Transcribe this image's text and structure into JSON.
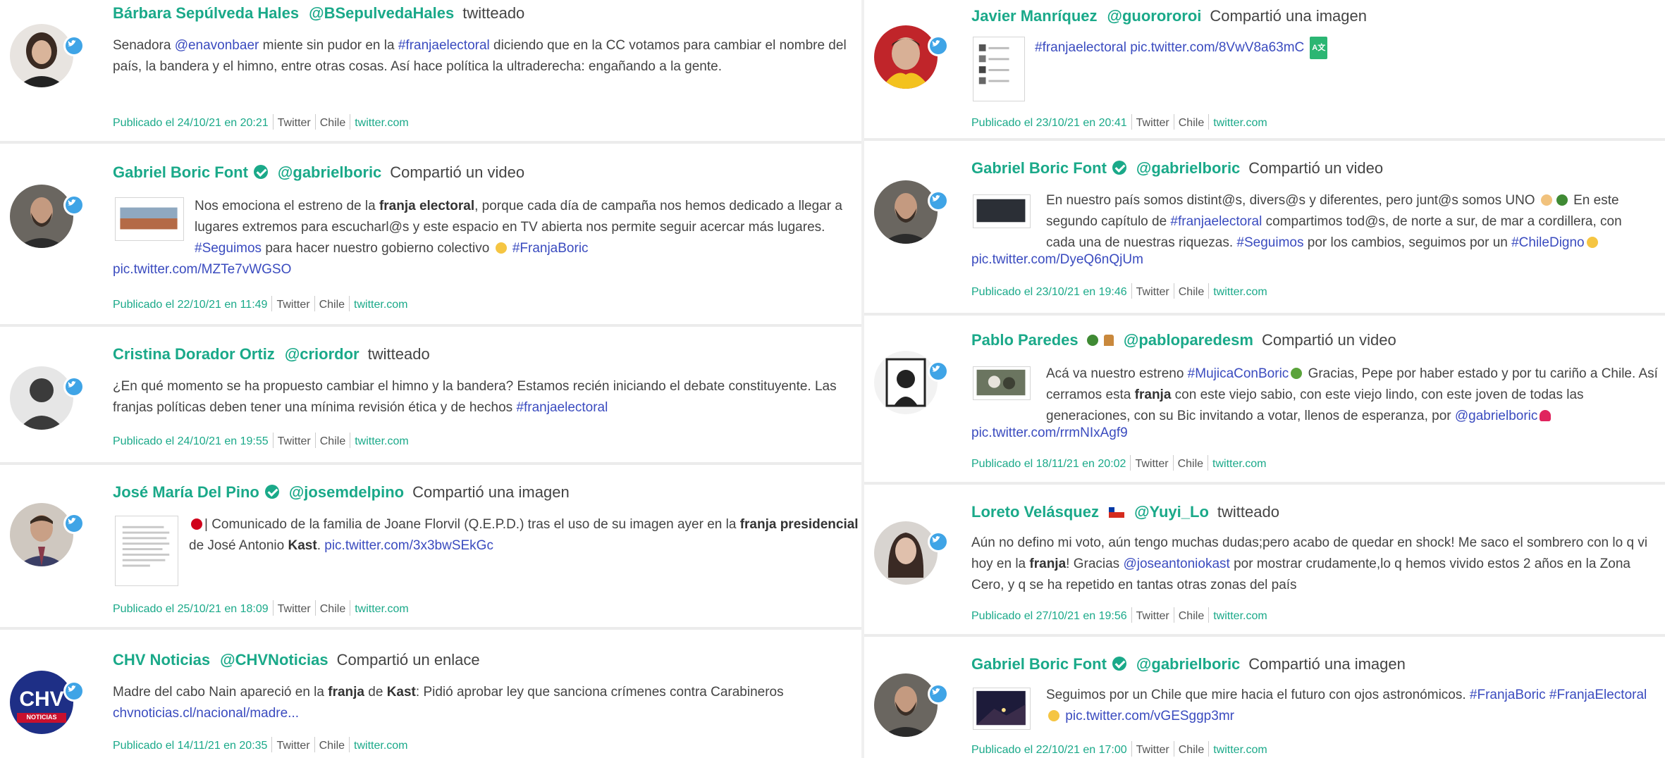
{
  "left": [
    {
      "author": "Bárbara Sepúlveda Hales",
      "handle": "@BSepulvedaHales",
      "action": "twitteado",
      "body": [
        {
          "t": "Senadora "
        },
        {
          "t": "@enavonbaer",
          "h": 1
        },
        {
          "t": " miente sin pudor en la "
        },
        {
          "t": "#franjaelectoral",
          "h": 1
        },
        {
          "t": " diciendo que en la CC votamos para cambiar el nombre del país, la bandera y el himno, entre otras cosas. Así hace política la ultraderecha: engañando a la gente."
        }
      ],
      "published": "Publicado el 24/10/21 en 20:21",
      "source": "Twitter",
      "country": "Chile",
      "domain": "twitter.com"
    },
    {
      "author": "Gabriel Boric Font",
      "handle": "@gabrielboric",
      "action": "Compartió un video",
      "body": [
        {
          "t": "Nos emociona el estreno de la "
        },
        {
          "t": "franja electoral",
          "b": 1
        },
        {
          "t": ", porque cada día de campaña nos hemos dedicado a llegar a lugares extremos para escucharl@s y este espacio en TV abierta nos permite seguir acercar más lugares. "
        },
        {
          "t": "#Seguimos",
          "h": 1
        },
        {
          "t": " para hacer nuestro gobierno colectivo "
        },
        {
          "e": "sun"
        },
        {
          "t": " "
        },
        {
          "t": "#FranjaBoric",
          "h": 1
        }
      ],
      "link": "pic.twitter.com/MZTe7vWGSO",
      "published": "Publicado el 22/10/21 en 11:49",
      "source": "Twitter",
      "country": "Chile",
      "domain": "twitter.com"
    },
    {
      "author": "Cristina Dorador Ortiz",
      "handle": "@criordor",
      "action": "twitteado",
      "body": [
        {
          "t": "¿En qué momento se ha propuesto cambiar el himno y la bandera? Estamos recién iniciando el debate constituyente. Las franjas políticas deben tener una mínima revisión ética y de hechos "
        },
        {
          "t": "#franjaelectoral",
          "h": 1
        }
      ],
      "published": "Publicado el 24/10/21 en 19:55",
      "source": "Twitter",
      "country": "Chile",
      "domain": "twitter.com"
    },
    {
      "author": "José María Del Pino",
      "handle": "@josemdelpino",
      "action": "Compartió una imagen",
      "body": [
        {
          "e": "red"
        },
        {
          "t": "| Comunicado de la familia de Joane Florvil (Q.E.P.D.) tras el uso de su imagen ayer en la "
        },
        {
          "t": "franja presidencial",
          "b": 1
        },
        {
          "t": " de José Antonio "
        },
        {
          "t": "Kast",
          "b": 1
        },
        {
          "t": ". "
        },
        {
          "t": "pic.twitter.com/3x3bwSEkGc",
          "h": 1
        }
      ],
      "published": "Publicado el 25/10/21 en 18:09",
      "source": "Twitter",
      "country": "Chile",
      "domain": "twitter.com"
    },
    {
      "author": "CHV Noticias",
      "handle": "@CHVNoticias",
      "action": "Compartió un enlace",
      "logo_text": "NOTICIAS",
      "body": [
        {
          "t": "Madre del cabo Nain apareció en la "
        },
        {
          "t": "franja",
          "b": 1
        },
        {
          "t": " de "
        },
        {
          "t": "Kast",
          "b": 1
        },
        {
          "t": ": Pidió aprobar ley que sanciona crímenes contra Carabineros "
        },
        {
          "t": "chvnoticias.cl/nacional/madre...",
          "h": 1
        }
      ],
      "published": "Publicado el 14/11/21 en 20:35",
      "source": "Twitter",
      "country": "Chile",
      "domain": "twitter.com"
    }
  ],
  "right": [
    {
      "author": "Javier Manríquez",
      "handle": "@guorororoi",
      "action": "Compartió una imagen",
      "body": [
        {
          "t": "#franjaelectoral pic.twitter.com/8VwV8a63mC",
          "h": 1
        }
      ],
      "translate": "A文",
      "published": "Publicado el 23/10/21 en 20:41",
      "source": "Twitter",
      "country": "Chile",
      "domain": "twitter.com"
    },
    {
      "author": "Gabriel Boric Font",
      "handle": "@gabrielboric",
      "action": "Compartió un video",
      "body": [
        {
          "t": "En nuestro país somos distint@s, divers@s y diferentes, pero junt@s somos UNO "
        },
        {
          "e": "hand"
        },
        {
          "e": "tree"
        },
        {
          "t": " En este segundo capítulo de "
        },
        {
          "t": "#franjaelectoral",
          "h": 1
        },
        {
          "t": " compartimos tod@s, de norte a sur, de mar a cordillera, con cada una de nuestras riquezas. "
        },
        {
          "t": "#Seguimos",
          "h": 1
        },
        {
          "t": " por los cambios, seguimos por un "
        },
        {
          "t": "#ChileDigno",
          "h": 1
        },
        {
          "e": "sun"
        }
      ],
      "link": "pic.twitter.com/DyeQ6nQjUm",
      "published": "Publicado el 23/10/21 en 19:46",
      "source": "Twitter",
      "country": "Chile",
      "domain": "twitter.com"
    },
    {
      "author": "Pablo Paredes",
      "handle": "@pabloparedesm",
      "action": "Compartió un video",
      "body": [
        {
          "t": "Acá va nuestro estreno "
        },
        {
          "t": "#MujicaConBoric",
          "h": 1
        },
        {
          "e": "plant"
        },
        {
          "t": " Gracias, Pepe por haber estado y por tu cariño a Chile. Así cerramos esta "
        },
        {
          "t": "franja",
          "b": 1
        },
        {
          "t": " con este viejo sabio, con este viejo lindo, con este joven de todas las generaciones, con su Bic invitando a votar, llenos de esperanza, por "
        },
        {
          "t": "@gabrielboric",
          "h": 1
        },
        {
          "e": "heart"
        }
      ],
      "link": "pic.twitter.com/rrmNIxAgf9",
      "published": "Publicado el 18/11/21 en 20:02",
      "source": "Twitter",
      "country": "Chile",
      "domain": "twitter.com"
    },
    {
      "author": "Loreto Velásquez",
      "handle": "@Yuyi_Lo",
      "action": "twitteado",
      "body": [
        {
          "t": "Aún no defino mi voto, aún tengo muchas dudas;pero acabo de quedar en shock! Me saco el sombrero con lo q vi hoy en la "
        },
        {
          "t": "franja",
          "b": 1
        },
        {
          "t": "! Gracias "
        },
        {
          "t": "@joseantoniokast",
          "h": 1
        },
        {
          "t": " por mostrar crudamente,lo q hemos vivido estos 2 años en la Zona Cero, y q se ha repetido en tantas otras zonas del país"
        }
      ],
      "published": "Publicado el 27/10/21 en 19:56",
      "source": "Twitter",
      "country": "Chile",
      "domain": "twitter.com"
    },
    {
      "author": "Gabriel Boric Font",
      "handle": "@gabrielboric",
      "action": "Compartió una imagen",
      "body": [
        {
          "t": "Seguimos por un Chile que mire hacia el futuro con ojos astronómicos. "
        },
        {
          "t": "#FranjaBoric",
          "h": 1
        },
        {
          "t": " "
        },
        {
          "t": "#FranjaElectoral",
          "h": 1
        },
        {
          "t": " "
        },
        {
          "e": "sun"
        },
        {
          "t": " "
        },
        {
          "t": "pic.twitter.com/vGESggp3mr",
          "h": 1
        }
      ],
      "published": "Publicado el 22/10/21 en 17:00",
      "source": "Twitter",
      "country": "Chile",
      "domain": "twitter.com"
    }
  ],
  "colors": {
    "accent": "#1aa989",
    "link": "#3a4bbf",
    "twitter": "#3fa4e6",
    "text": "#444444",
    "divider": "#ececec"
  }
}
